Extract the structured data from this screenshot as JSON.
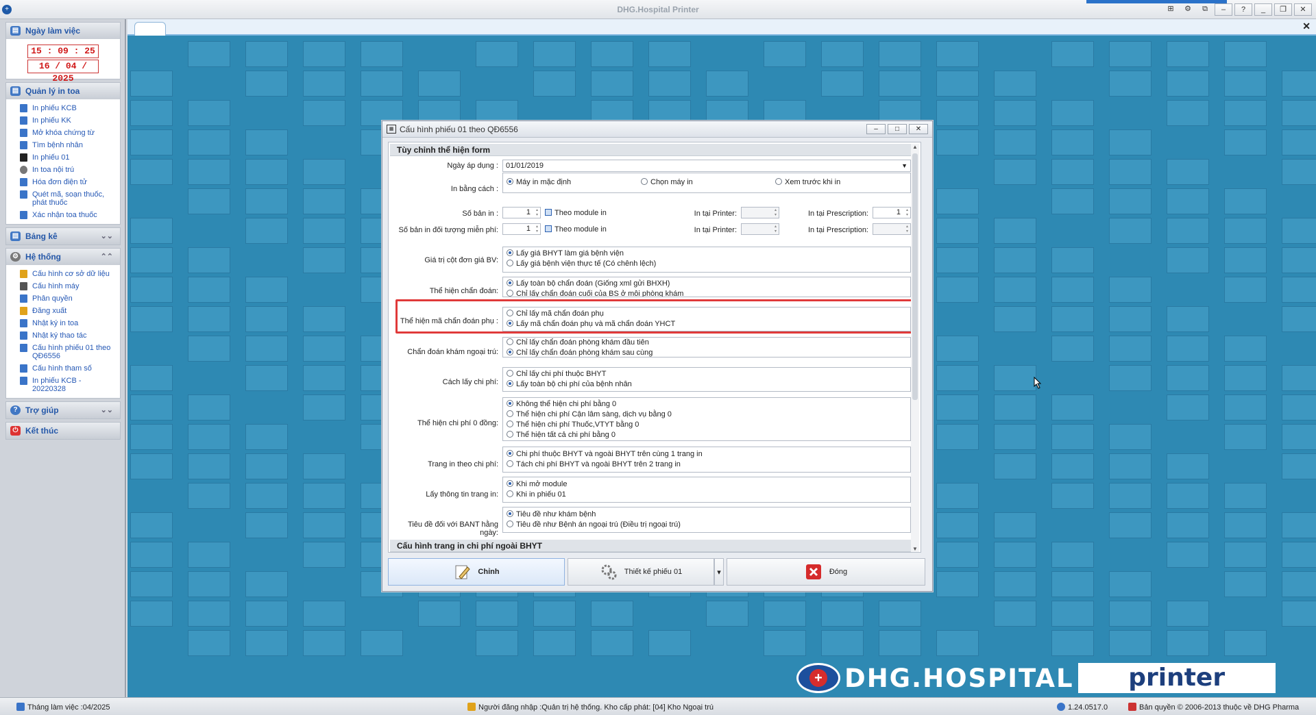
{
  "window": {
    "title": "DHG.Hospital Printer",
    "buttons": [
      "_",
      "□",
      "✕"
    ]
  },
  "sidebar": {
    "workday": {
      "title": "Ngày làm việc",
      "time": "15 : 09 : 25",
      "date": "16 / 04 / 2025"
    },
    "prescriptions": {
      "title": "Quản lý in toa",
      "items": [
        {
          "label": "In phiếu KCB"
        },
        {
          "label": "In phiếu KK"
        },
        {
          "label": "Mở khóa chứng từ"
        },
        {
          "label": "Tìm bệnh nhân"
        },
        {
          "label": "In phiếu 01"
        },
        {
          "label": "In toa nội trú"
        },
        {
          "label": "Hóa đơn điện tử"
        },
        {
          "label": "Quét mã, soạn thuốc, phát thuốc"
        },
        {
          "label": "Xác nhận toa thuốc"
        }
      ]
    },
    "reports": {
      "title": "Bảng kê"
    },
    "system": {
      "title": "Hệ thống",
      "items": [
        {
          "label": "Cấu hình cơ sở dữ liệu"
        },
        {
          "label": "Cấu hình máy"
        },
        {
          "label": "Phân quyền"
        },
        {
          "label": "Đăng xuất"
        },
        {
          "label": "Nhật ký in toa"
        },
        {
          "label": "Nhật ký thao tác"
        },
        {
          "label": "Cấu hình phiếu 01 theo QĐ6556"
        },
        {
          "label": "Cấu hình tham số"
        },
        {
          "label": "In phiếu KCB - 20220328"
        }
      ]
    },
    "help": {
      "title": "Trợ giúp"
    },
    "exit": {
      "title": "Kết thúc"
    }
  },
  "logo": {
    "brand": "DHG.HOSPITAL",
    "product": "printer"
  },
  "dialog": {
    "title": "Cấu hình phiếu 01 theo QĐ6556",
    "section1": "Tùy chỉnh thể hiện form",
    "apply_date": {
      "label": "Ngày áp dụng :",
      "value": "01/01/2019"
    },
    "print_method": {
      "label": "In bằng cách :",
      "options": [
        "Máy in mặc định",
        "Chọn máy in",
        "Xem trước khi in"
      ]
    },
    "copies": {
      "label": "Số bản in :",
      "value": "1",
      "module_label": "Theo module in",
      "printer_label": "In tại Printer:",
      "prescription_label": "In tại Prescription:",
      "prescription_value": "1"
    },
    "copies_free": {
      "label": "Số bản in đối tượng miễn phí:",
      "value": "1",
      "module_label": "Theo module in",
      "printer_label": "In tại Printer:",
      "prescription_label": "In tại Prescription:"
    },
    "unit_price": {
      "label": "Giá trị cột đơn giá BV:",
      "options": [
        "Lấy giá BHYT làm giá bệnh viện",
        "Lấy giá bệnh viện thực tế (Có chênh lệch)"
      ]
    },
    "diagnosis": {
      "label": "Thể hiện chẩn đoán:",
      "options": [
        "Lấy toàn bộ chẩn đoán (Giống xml gửi BHXH)",
        "Chỉ lấy chẩn đoán cuối của BS ở mỗi phòng khám"
      ]
    },
    "sub_diagnosis": {
      "label": "Thể hiện mã chẩn đoán phụ :",
      "options": [
        "Chỉ lấy mã chẩn đoán phụ",
        "Lấy mã chẩn đoán phụ và mã chẩn đoán YHCT"
      ]
    },
    "outpatient_diag": {
      "label": "Chẩn đoán khám ngoại trú:",
      "options": [
        "Chỉ lấy chẩn đoán phòng khám đầu tiên",
        "Chỉ lấy chẩn đoán phòng khám sau cùng"
      ]
    },
    "cost_method": {
      "label": "Cách lấy chi phí:",
      "options": [
        "Chỉ lấy chi phí thuộc BHYT",
        "Lấy toàn bộ chi phí của bệnh nhân"
      ]
    },
    "zero_cost": {
      "label": "Thể hiện chi phí 0 đồng:",
      "options": [
        "Không thể hiện chi phí bằng 0",
        "Thể hiện chi phí Cận lâm sàng, dịch vụ bằng 0",
        "Thể hiện chi phí Thuốc,VTYT bằng 0",
        "Thể hiện tất cả chi phí bằng 0"
      ]
    },
    "page_cost": {
      "label": "Trang in theo chi phí:",
      "options": [
        "Chi phí thuộc BHYT và ngoài BHYT trên cùng 1 trang in",
        "Tách chi phí BHYT và ngoài BHYT trên 2 trang in"
      ]
    },
    "page_info": {
      "label": "Lấy thông tin trang in:",
      "options": [
        "Khi mở module",
        "Khi in phiếu 01"
      ]
    },
    "bant_title": {
      "label": "Tiêu đề đối với BANT hằng ngày:",
      "options": [
        "Tiêu đề như khám bệnh",
        "Tiêu đề như Bệnh án ngoại trú (Điều trị ngoại trú)"
      ]
    },
    "section2": "Cấu hình trang in chi phí ngoài BHYT",
    "buttons": {
      "edit": "Chỉnh",
      "design": "Thiết kế phiếu 01",
      "close": "Đóng"
    }
  },
  "statusbar": {
    "month": "Tháng làm việc :04/2025",
    "user": "Người đăng nhập :Quản trị hệ thống. Kho cấp phát: [04] Kho Ngoại trú",
    "version": "1.24.0517.0",
    "copyright": "Bản quyền © 2006-2013 thuộc về DHG Pharma"
  }
}
